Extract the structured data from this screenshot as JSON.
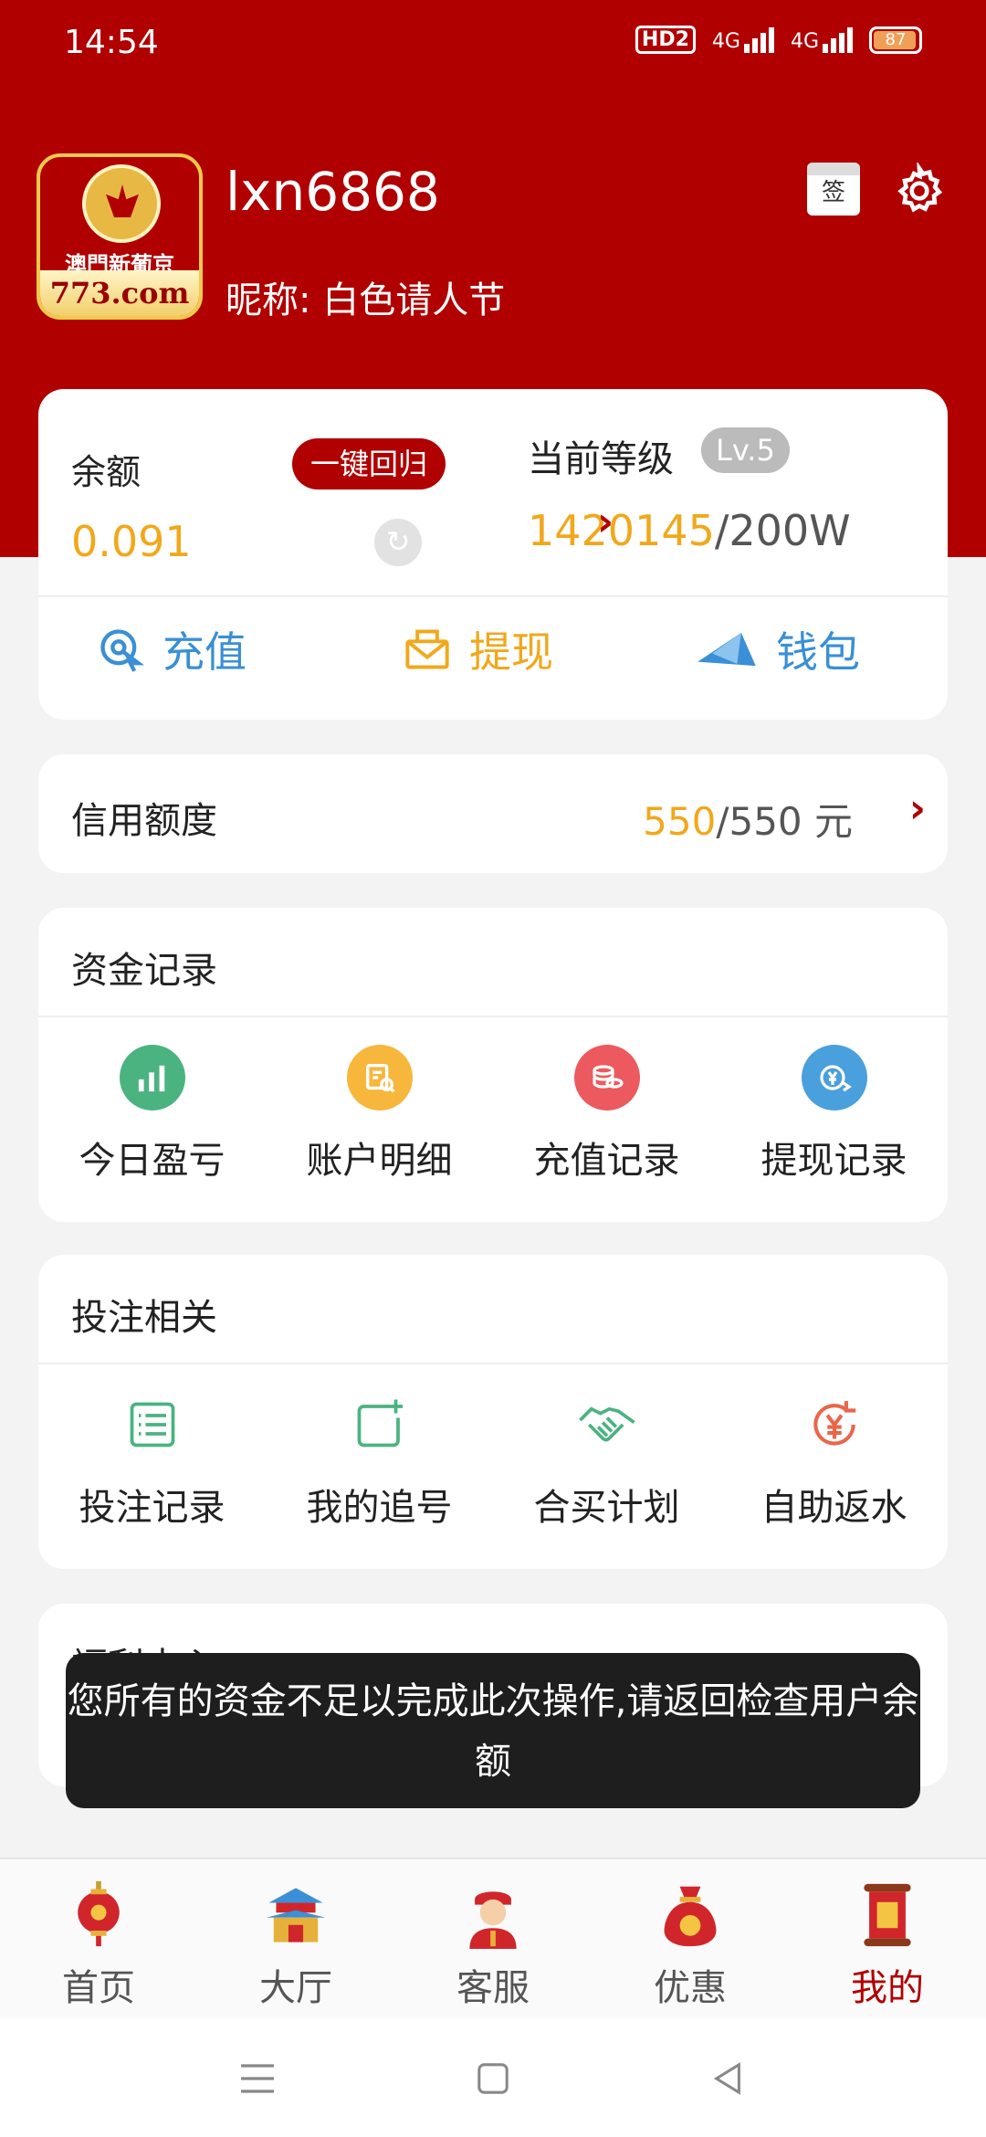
{
  "status": {
    "time": "14:54",
    "hd": "HD2",
    "net1": "4G",
    "net2": "4G",
    "battery": "87"
  },
  "profile": {
    "username": "lxn6868",
    "nickname": "昵称: 白色请人节",
    "logo_brand": "澳門新葡京",
    "logo_domain": "773.com",
    "sign_icon": "签"
  },
  "balance": {
    "label": "余额",
    "reclaim_label": "一键回归",
    "value": "0.091",
    "level_label": "当前等级",
    "level_badge": "Lv.5",
    "level_current": "1420145",
    "level_target": "/200W"
  },
  "actions": [
    {
      "label": "充值",
      "icon": "recharge-icon",
      "color": "#3a8fd6"
    },
    {
      "label": "提现",
      "icon": "withdraw-icon",
      "color": "#f0a81c"
    },
    {
      "label": "钱包",
      "icon": "wallet-icon",
      "color": "#3a8fd6"
    }
  ],
  "credit": {
    "label": "信用额度",
    "current": "550",
    "total": "/550 元"
  },
  "funds": {
    "title": "资金记录",
    "items": [
      {
        "label": "今日盈亏",
        "icon": "chart-icon",
        "color": "#4bb380"
      },
      {
        "label": "账户明细",
        "icon": "document-search-icon",
        "color": "#f6b73c"
      },
      {
        "label": "充值记录",
        "icon": "coins-icon",
        "color": "#ec5a5f"
      },
      {
        "label": "提现记录",
        "icon": "yuan-transfer-icon",
        "color": "#4aa0dc"
      }
    ]
  },
  "betting": {
    "title": "投注相关",
    "items": [
      {
        "label": "投注记录",
        "icon": "list-icon",
        "color": "#4bb380"
      },
      {
        "label": "我的追号",
        "icon": "add-note-icon",
        "color": "#4bb380"
      },
      {
        "label": "合买计划",
        "icon": "handshake-icon",
        "color": "#4bb380"
      },
      {
        "label": "自助返水",
        "icon": "yuan-refund-icon",
        "color": "#e8674a"
      }
    ]
  },
  "welfare": {
    "title": "福利中心"
  },
  "toast": {
    "message": "您所有的资金不足以完成此次操作,请返回检查用户余额"
  },
  "tabs": [
    {
      "label": "首页",
      "icon": "lantern-icon"
    },
    {
      "label": "大厅",
      "icon": "temple-icon"
    },
    {
      "label": "客服",
      "icon": "service-agent-icon"
    },
    {
      "label": "优惠",
      "icon": "money-bag-icon"
    },
    {
      "label": "我的",
      "icon": "scroll-icon",
      "active": true
    }
  ],
  "colors": {
    "brand": "#b00000",
    "accent": "#f0a81c"
  }
}
